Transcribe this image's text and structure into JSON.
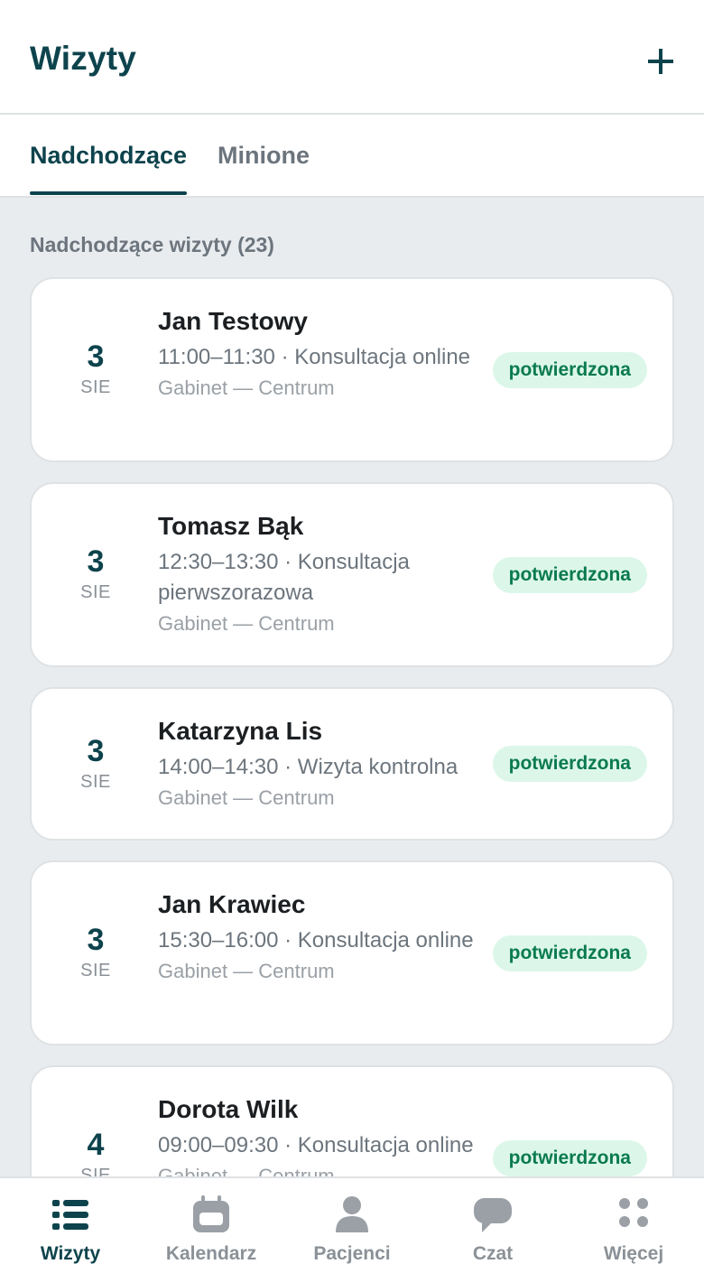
{
  "header": {
    "title": "Wizyty",
    "add_icon": "plus-icon"
  },
  "tabs": [
    {
      "label": "Nadchodzące",
      "active": true
    },
    {
      "label": "Minione",
      "active": false
    }
  ],
  "section": {
    "heading": "Nadchodzące wizyty (23)"
  },
  "appointments": [
    {
      "day": "3",
      "month": "SIE",
      "name": "Jan Testowy",
      "details": "11:00–11:30 · Konsultacja online",
      "location": "Gabinet — Centrum",
      "status": "potwierdzona"
    },
    {
      "day": "3",
      "month": "SIE",
      "name": "Tomasz Bąk",
      "details": "12:30–13:30 · Konsultacja pierwszorazowa",
      "location": "Gabinet — Centrum",
      "status": "potwierdzona"
    },
    {
      "day": "3",
      "month": "SIE",
      "name": "Katarzyna Lis",
      "details": "14:00–14:30 · Wizyta kontrolna",
      "location": "Gabinet — Centrum",
      "status": "potwierdzona"
    },
    {
      "day": "3",
      "month": "SIE",
      "name": "Jan Krawiec",
      "details": "15:30–16:00 · Konsultacja online",
      "location": "Gabinet — Centrum",
      "status": "potwierdzona"
    },
    {
      "day": "4",
      "month": "SIE",
      "name": "Dorota Wilk",
      "details": "09:00–09:30 · Konsultacja online",
      "location": "Gabinet — Centrum",
      "status": "potwierdzona"
    }
  ],
  "nav": [
    {
      "label": "Wizyty",
      "icon": "list-icon",
      "active": true
    },
    {
      "label": "Kalendarz",
      "icon": "calendar-icon",
      "active": false
    },
    {
      "label": "Pacjenci",
      "icon": "person-icon",
      "active": false
    },
    {
      "label": "Czat",
      "icon": "chat-bubble-icon",
      "active": false
    },
    {
      "label": "Więcej",
      "icon": "more-grid-icon",
      "active": false
    }
  ],
  "colors": {
    "primary": "#0d434c",
    "muted": "#6c757d",
    "background": "#e9ecef",
    "badge_bg": "#dcf7ea",
    "badge_text": "#0a7a4f",
    "nav_inactive": "#8a9197"
  }
}
